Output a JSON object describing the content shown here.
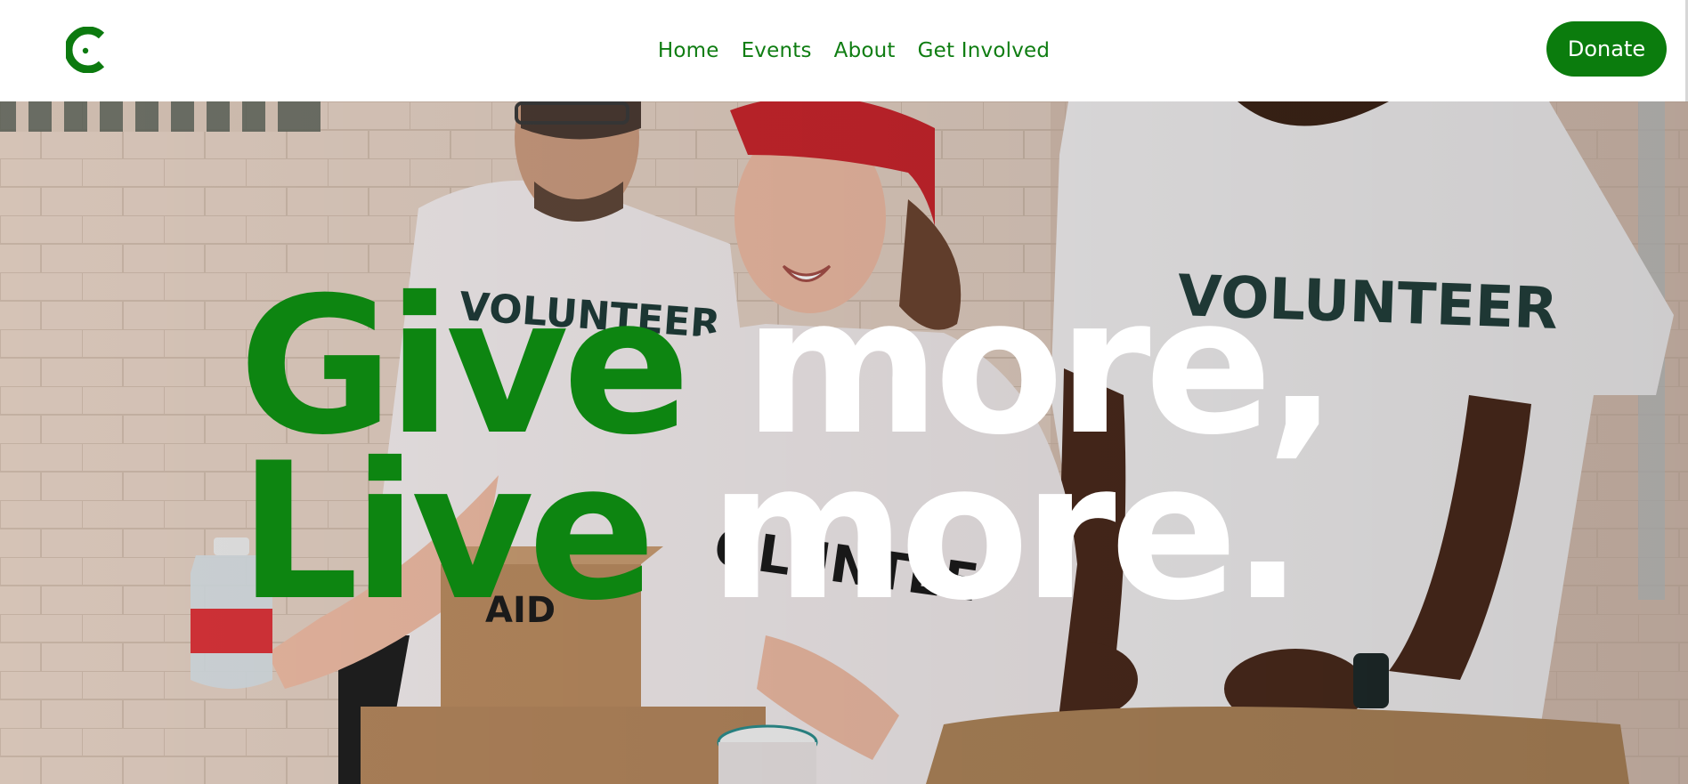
{
  "brand": {
    "logo_icon": "c-monogram-people-icon",
    "accent_color": "#0b7c0d"
  },
  "nav": {
    "items": [
      {
        "label": "Home"
      },
      {
        "label": "Events"
      },
      {
        "label": "About"
      },
      {
        "label": "Get Involved"
      }
    ]
  },
  "header": {
    "donate_label": "Donate"
  },
  "hero": {
    "line1_green": "Give",
    "line1_white": " more,",
    "line2_green": "Live",
    "line2_white": " more.",
    "image_shirt_text": "VOLUNTEER",
    "image_box_text": "AID"
  }
}
